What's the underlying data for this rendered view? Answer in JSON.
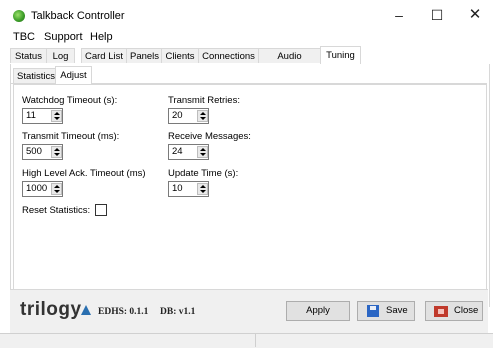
{
  "window": {
    "title": "Talkback Controller",
    "minimize_glyph": "–",
    "maximize_glyph": "☐",
    "close_glyph": "✕"
  },
  "menu": {
    "items": [
      "TBC",
      "Support",
      "Help"
    ]
  },
  "tabs": [
    "Status",
    "Log",
    "Card List",
    "Panels",
    "Clients",
    "Connections",
    "Audio Routes",
    "Tuning"
  ],
  "active_tab": "Tuning",
  "subtabs": [
    "Statistics",
    "Adjust"
  ],
  "active_subtab": "Adjust",
  "fields": {
    "watchdog_timeout": {
      "label": "Watchdog Timeout (s):",
      "value": "11"
    },
    "transmit_timeout": {
      "label": "Transmit Timeout (ms):",
      "value": "500"
    },
    "high_level_ack": {
      "label": "High Level Ack. Timeout (ms)",
      "value": "1000"
    },
    "transmit_retries": {
      "label": "Transmit Retries:",
      "value": "20"
    },
    "receive_messages": {
      "label": "Receive Messages:",
      "value": "24"
    },
    "update_time": {
      "label": "Update Time (s):",
      "value": "10"
    }
  },
  "reset_statistics": {
    "label": "Reset Statistics:",
    "checked": false
  },
  "footer": {
    "logo_text": "trilogy",
    "edhs": "EDHS: 0.1.1",
    "db": "DB: v1.1",
    "apply_label": "Apply",
    "save_label": "Save",
    "close_label": "Close"
  },
  "icons": {
    "app": "talkback-app-icon",
    "save": "floppy-disk-icon",
    "close": "close-window-icon"
  },
  "colors": {
    "logo_mark": "#2a6fb0",
    "save_icon": "#2b66c4",
    "close_icon": "#c0392b"
  }
}
